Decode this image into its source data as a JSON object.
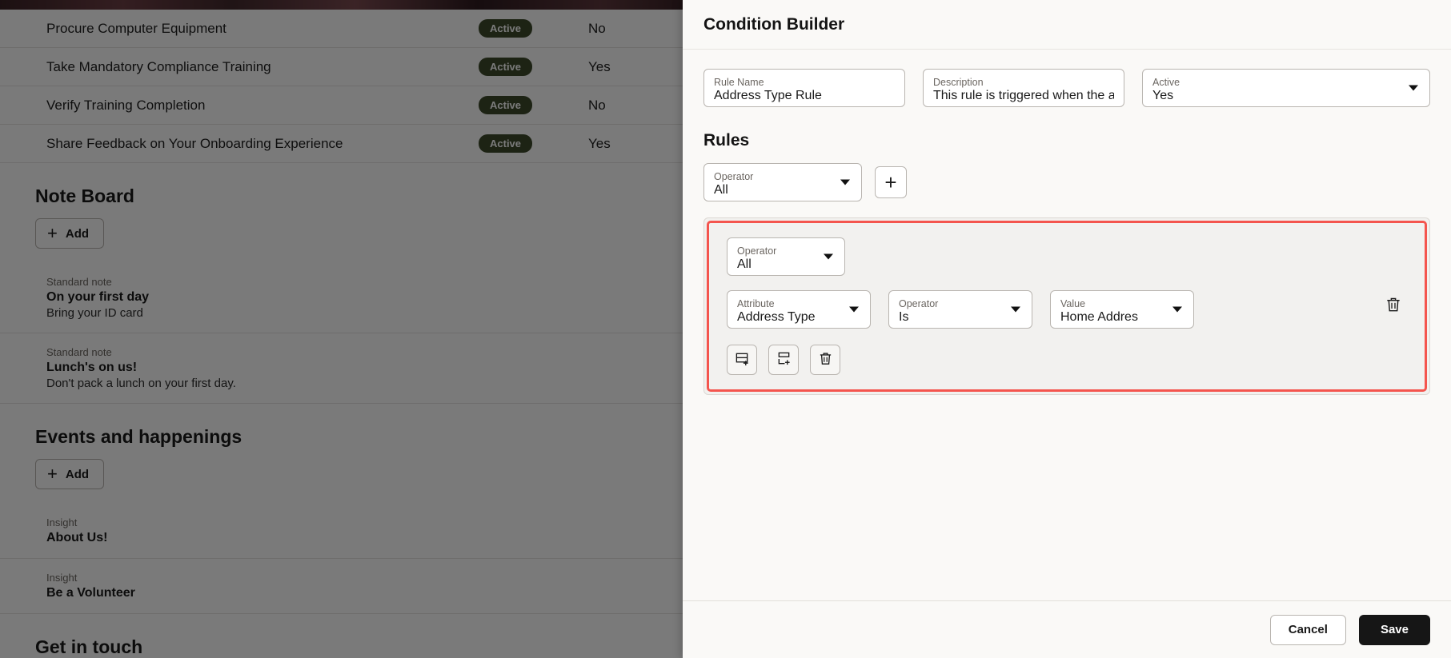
{
  "background": {
    "tasks": [
      {
        "name": "Procure Computer Equipment",
        "status": "Active",
        "flag": "No"
      },
      {
        "name": "Take Mandatory Compliance Training",
        "status": "Active",
        "flag": "Yes"
      },
      {
        "name": "Verify Training Completion",
        "status": "Active",
        "flag": "No"
      },
      {
        "name": "Share Feedback on Your Onboarding Experience",
        "status": "Active",
        "flag": "Yes"
      }
    ],
    "note_board": {
      "title": "Note Board",
      "add_label": "Add",
      "notes": [
        {
          "kind": "Standard note",
          "title": "On your first day",
          "sub": "Bring your ID card"
        },
        {
          "kind": "Standard note",
          "title": "Lunch's on us!",
          "sub": "Don't pack a lunch on your first day."
        }
      ]
    },
    "events": {
      "title": "Events and happenings",
      "add_label": "Add",
      "items": [
        {
          "kind": "Insight",
          "title": "About Us!"
        },
        {
          "kind": "Insight",
          "title": "Be a Volunteer"
        }
      ]
    },
    "get_in_touch_title": "Get in touch"
  },
  "panel": {
    "title": "Condition Builder",
    "fields": {
      "rule_name": {
        "label": "Rule Name",
        "value": "Address Type Rule"
      },
      "description": {
        "label": "Description",
        "value": "This rule is triggered when the applic"
      },
      "active": {
        "label": "Active",
        "value": "Yes"
      }
    },
    "rules": {
      "heading": "Rules",
      "top_operator": {
        "label": "Operator",
        "value": "All"
      },
      "add_button_label": "+",
      "group": {
        "operator": {
          "label": "Operator",
          "value": "All"
        },
        "condition": {
          "attribute": {
            "label": "Attribute",
            "value": "Address Type"
          },
          "operator": {
            "label": "Operator",
            "value": "Is"
          },
          "value": {
            "label": "Value",
            "value": "Home Addres"
          }
        }
      }
    },
    "footer": {
      "cancel_label": "Cancel",
      "save_label": "Save"
    },
    "colors": {
      "highlight": "#f4554e",
      "save_bg": "#161616",
      "panel_bg": "#faf9f7",
      "badge_bg": "#3d4a2b"
    }
  }
}
